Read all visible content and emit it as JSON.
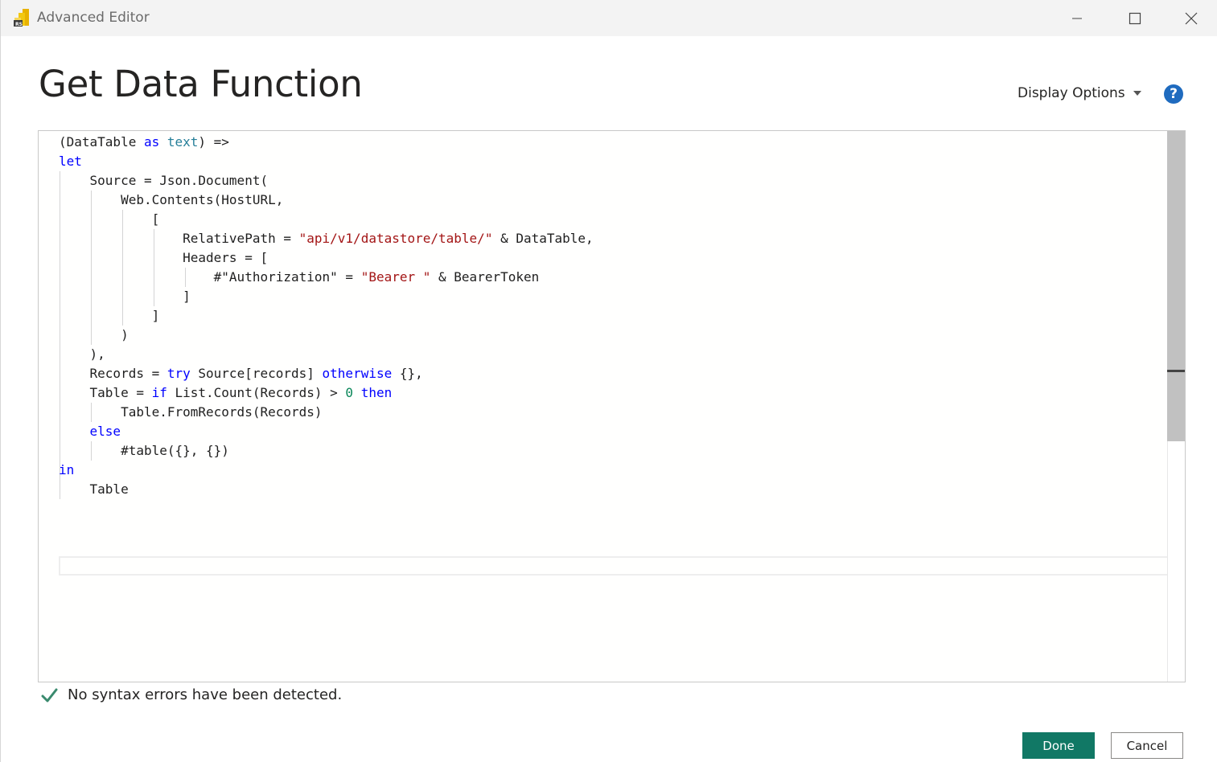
{
  "window": {
    "title": "Advanced Editor",
    "app_icon": "power-bi-icon",
    "controls": [
      "minimize-icon",
      "maximize-icon",
      "close-icon"
    ]
  },
  "header": {
    "title": "Get Data Function",
    "display_options_label": "Display Options",
    "help_icon": "help-icon"
  },
  "editor": {
    "lines": [
      {
        "segments": [
          {
            "t": "(DataTable ",
            "c": ""
          },
          {
            "t": "as",
            "c": "kw"
          },
          {
            "t": " ",
            "c": ""
          },
          {
            "t": "text",
            "c": "type"
          },
          {
            "t": ") =>",
            "c": ""
          }
        ]
      },
      {
        "segments": [
          {
            "t": "let",
            "c": "kw"
          }
        ]
      },
      {
        "segments": [
          {
            "t": "    Source = Json.Document(",
            "c": ""
          }
        ]
      },
      {
        "segments": [
          {
            "t": "        Web.Contents(HostURL,",
            "c": ""
          }
        ]
      },
      {
        "segments": [
          {
            "t": "            [",
            "c": ""
          }
        ]
      },
      {
        "segments": [
          {
            "t": "                RelativePath = ",
            "c": ""
          },
          {
            "t": "\"api/v1/datastore/table/\"",
            "c": "str"
          },
          {
            "t": " & DataTable,",
            "c": ""
          }
        ]
      },
      {
        "segments": [
          {
            "t": "                Headers = [",
            "c": ""
          }
        ]
      },
      {
        "segments": [
          {
            "t": "                    #\"Authorization\" = ",
            "c": ""
          },
          {
            "t": "\"Bearer \"",
            "c": "str"
          },
          {
            "t": " & BearerToken",
            "c": ""
          }
        ]
      },
      {
        "segments": [
          {
            "t": "                ]",
            "c": ""
          }
        ]
      },
      {
        "segments": [
          {
            "t": "            ]",
            "c": ""
          }
        ]
      },
      {
        "segments": [
          {
            "t": "        )",
            "c": ""
          }
        ]
      },
      {
        "segments": [
          {
            "t": "    ),",
            "c": ""
          }
        ]
      },
      {
        "segments": [
          {
            "t": "    Records = ",
            "c": ""
          },
          {
            "t": "try",
            "c": "kw"
          },
          {
            "t": " Source[records] ",
            "c": ""
          },
          {
            "t": "otherwise",
            "c": "kw"
          },
          {
            "t": " {},",
            "c": ""
          }
        ]
      },
      {
        "segments": [
          {
            "t": "    Table = ",
            "c": ""
          },
          {
            "t": "if",
            "c": "kw"
          },
          {
            "t": " List.Count(Records) > ",
            "c": ""
          },
          {
            "t": "0",
            "c": "num"
          },
          {
            "t": " ",
            "c": ""
          },
          {
            "t": "then",
            "c": "kw"
          }
        ]
      },
      {
        "segments": [
          {
            "t": "        Table.FromRecords(Records)",
            "c": ""
          }
        ]
      },
      {
        "segments": [
          {
            "t": "    ",
            "c": ""
          },
          {
            "t": "else",
            "c": "kw"
          }
        ]
      },
      {
        "segments": [
          {
            "t": "        #table({}, {})",
            "c": ""
          }
        ]
      },
      {
        "segments": [
          {
            "t": "in",
            "c": "kw"
          }
        ]
      },
      {
        "segments": [
          {
            "t": "    Table",
            "c": ""
          }
        ]
      }
    ]
  },
  "status": {
    "icon": "checkmark-icon",
    "text": "No syntax errors have been detected."
  },
  "buttons": {
    "done": "Done",
    "cancel": "Cancel"
  },
  "colors": {
    "keyword": "#0000ff",
    "type": "#267f99",
    "string": "#a31515",
    "number": "#098658",
    "done_button": "#117865",
    "help": "#1f6bbf",
    "check": "#3a8a6e"
  }
}
